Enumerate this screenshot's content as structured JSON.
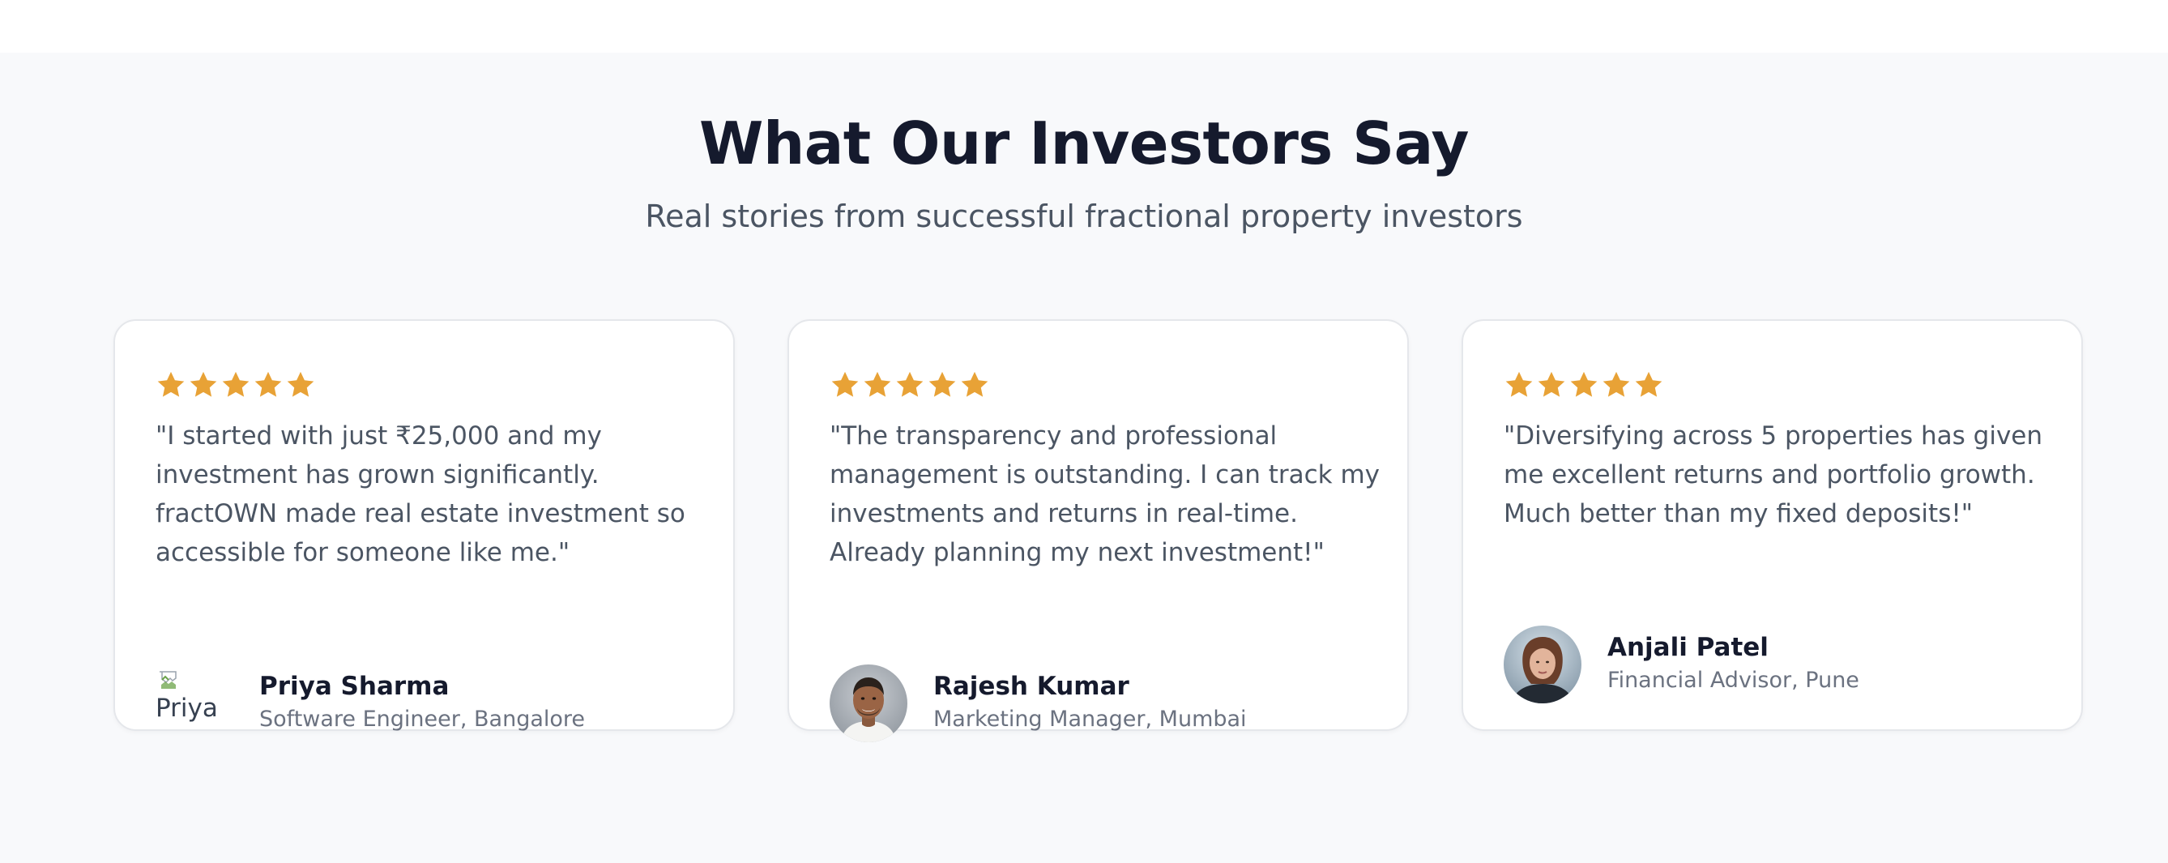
{
  "section": {
    "title": "What Our Investors Say",
    "subtitle": "Real stories from successful fractional property investors"
  },
  "star_color": "#e8a236",
  "testimonials": [
    {
      "rating": 5,
      "quote": "\"I started with just ₹25,000 and my investment has grown significantly. fractOWN made real estate investment so accessible for someone like me.\"",
      "name": "Priya Sharma",
      "role": "Software Engineer, Bangalore",
      "avatar_alt": "Priya",
      "avatar": "broken-image-icon"
    },
    {
      "rating": 5,
      "quote": "\"The transparency and professional management is outstanding. I can track my investments and returns in real-time. Already planning my next investment!\"",
      "name": "Rajesh Kumar",
      "role": "Marketing Manager, Mumbai",
      "avatar": "man-portrait-photo"
    },
    {
      "rating": 5,
      "quote": "\"Diversifying across 5 properties has given me excellent returns and portfolio growth. Much better than my fixed deposits!\"",
      "name": "Anjali Patel",
      "role": "Financial Advisor, Pune",
      "avatar": "woman-portrait-photo"
    }
  ]
}
